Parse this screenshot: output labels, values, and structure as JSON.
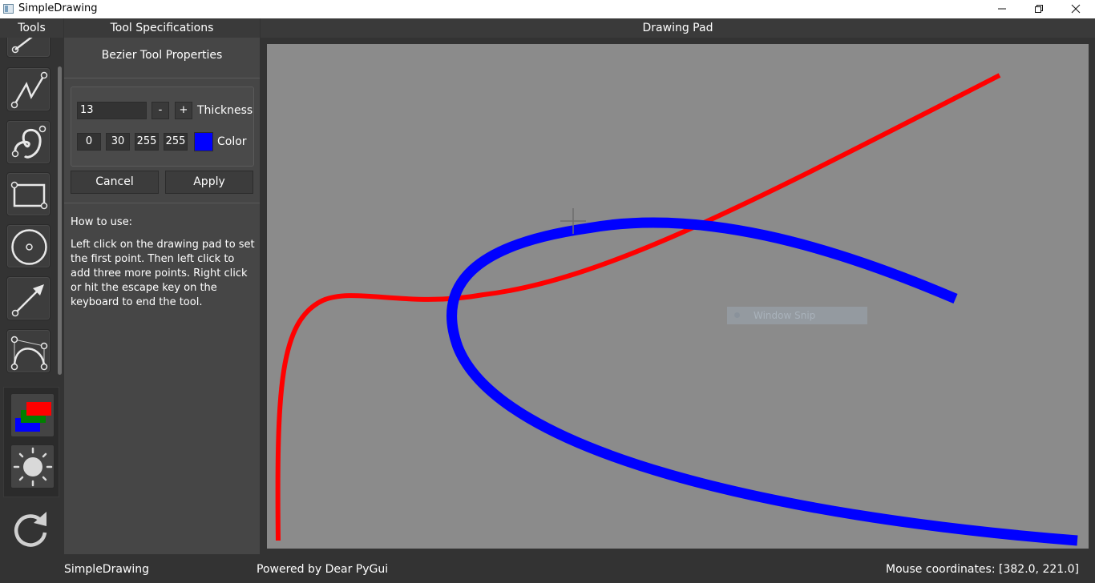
{
  "window": {
    "title": "SimpleDrawing",
    "controls": [
      "minimize-icon",
      "restore-icon",
      "close-icon"
    ]
  },
  "tools_panel": {
    "header": "Tools",
    "items": [
      {
        "name": "line-tool",
        "icon": "line-icon"
      },
      {
        "name": "polyline-tool",
        "icon": "polyline-icon"
      },
      {
        "name": "freehand-tool",
        "icon": "freehand-icon"
      },
      {
        "name": "rectangle-tool",
        "icon": "rectangle-icon"
      },
      {
        "name": "circle-tool",
        "icon": "circle-icon"
      },
      {
        "name": "arrow-tool",
        "icon": "arrow-icon"
      },
      {
        "name": "bezier-tool",
        "icon": "bezier-icon"
      }
    ],
    "extra": [
      {
        "name": "layers-tool",
        "icon": "layers-icon"
      },
      {
        "name": "brightness-tool",
        "icon": "sun-icon"
      }
    ],
    "redo": {
      "icon": "redo-icon"
    }
  },
  "spec_panel": {
    "header": "Tool Specifications",
    "subtitle": "Bezier Tool Properties",
    "thickness": {
      "value": "13",
      "minus": "-",
      "plus": "+",
      "label": "Thickness"
    },
    "color": {
      "r": "0",
      "g": "30",
      "b": "255",
      "a": "255",
      "swatch": "#0000ff",
      "label": "Color"
    },
    "cancel_label": "Cancel",
    "apply_label": "Apply",
    "howto_title": "How to use:",
    "howto_text": "Left click on the drawing pad to set the first point. Then left click to add three more points. Right click or hit the escape key on the keyboard to end the tool."
  },
  "drawing_pad": {
    "header": "Drawing Pad",
    "background": "#8b8b8b",
    "strokes": [
      {
        "color": "#ff0000",
        "kind": "bezier"
      },
      {
        "color": "#0000ff",
        "kind": "bezier"
      }
    ],
    "overlay_label": "Window Snip"
  },
  "status_bar": {
    "app_name": "SimpleDrawing",
    "powered_by": "Powered by Dear PyGui",
    "mouse_coordinates": "Mouse coordinates: [382.0, 221.0]"
  }
}
